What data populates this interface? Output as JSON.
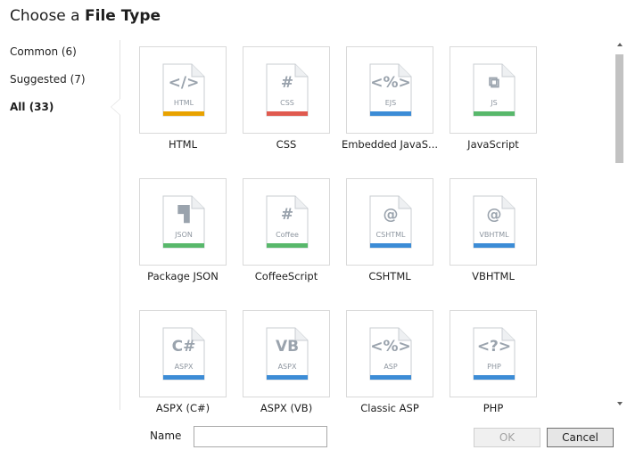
{
  "dialog": {
    "title_prefix": "Choose a ",
    "title_bold": "File Type"
  },
  "sidebar": {
    "items": [
      {
        "label": "Common (6)",
        "selected": false
      },
      {
        "label": "Suggested (7)",
        "selected": false
      },
      {
        "label": "All (33)",
        "selected": true
      }
    ]
  },
  "file_types": [
    {
      "label": "HTML",
      "glyph": "</>",
      "ext": "HTML",
      "color": "#e8a200",
      "icon": "html-file-icon"
    },
    {
      "label": "CSS",
      "glyph": "#",
      "ext": "CSS",
      "color": "#e05a4f",
      "icon": "css-file-icon"
    },
    {
      "label": "Embedded JavaS...",
      "glyph": "<%>",
      "ext": "EJS",
      "color": "#3c8cd6",
      "icon": "ejs-file-icon"
    },
    {
      "label": "JavaScript",
      "glyph": "⧉",
      "ext": "JS",
      "color": "#58b86b",
      "icon": "js-file-icon"
    },
    {
      "label": "Package JSON",
      "glyph": "▜",
      "ext": "JSON",
      "color": "#58b86b",
      "icon": "json-file-icon"
    },
    {
      "label": "CoffeeScript",
      "glyph": "#",
      "ext": "Coffee",
      "color": "#58b86b",
      "icon": "coffee-file-icon"
    },
    {
      "label": "CSHTML",
      "glyph": "@",
      "ext": "CSHTML",
      "color": "#3c8cd6",
      "icon": "cshtml-file-icon"
    },
    {
      "label": "VBHTML",
      "glyph": "@",
      "ext": "VBHTML",
      "color": "#3c8cd6",
      "icon": "vbhtml-file-icon"
    },
    {
      "label": "ASPX (C#)",
      "glyph": "C#",
      "ext": "ASPX",
      "color": "#3c8cd6",
      "icon": "aspx-cs-file-icon"
    },
    {
      "label": "ASPX (VB)",
      "glyph": "VB",
      "ext": "ASPX",
      "color": "#3c8cd6",
      "icon": "aspx-vb-file-icon"
    },
    {
      "label": "Classic ASP",
      "glyph": "<%>",
      "ext": "ASP",
      "color": "#3c8cd6",
      "icon": "asp-file-icon"
    },
    {
      "label": "PHP",
      "glyph": "<?>",
      "ext": "PHP",
      "color": "#3c8cd6",
      "icon": "php-file-icon"
    }
  ],
  "footer": {
    "name_label": "Name",
    "name_value": "",
    "ok_label": "OK",
    "cancel_label": "Cancel"
  }
}
